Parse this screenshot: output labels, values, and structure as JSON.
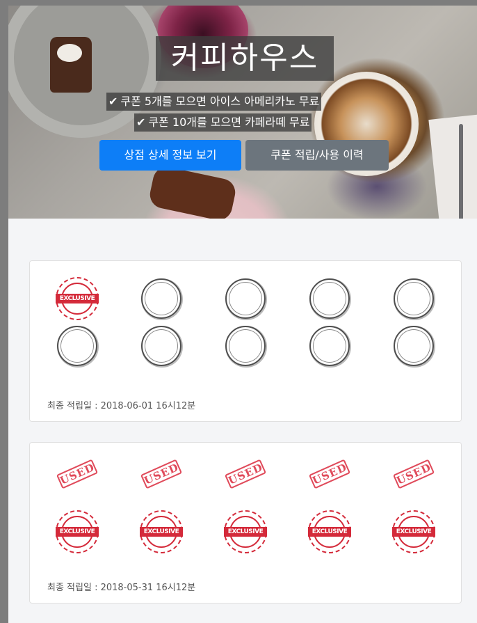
{
  "hero": {
    "title": "커피하우스",
    "reward_lines": [
      "쿠폰 5개를 모으면 아이스 아메리카노 무료",
      "쿠폰 10개를 모으면 카페라떼 무료"
    ],
    "buttons": {
      "store_detail": "상점 상세 정보 보기",
      "coupon_history": "쿠폰 적립/사용 이력"
    }
  },
  "cards": [
    {
      "slots": [
        "exclusive",
        "empty",
        "empty",
        "empty",
        "empty",
        "empty",
        "empty",
        "empty",
        "empty",
        "empty"
      ],
      "last_stamp": "최종 적립일 : 2018-06-01 16시12분"
    },
    {
      "slots": [
        "used",
        "used",
        "used",
        "used",
        "used",
        "exclusive",
        "exclusive",
        "exclusive",
        "exclusive",
        "exclusive"
      ],
      "last_stamp": "최종 적립일 : 2018-05-31 16시12분"
    }
  ],
  "stamp_labels": {
    "exclusive": "EXCLUSIVE",
    "used": "USED"
  },
  "colors": {
    "primary": "#0d7ef7",
    "secondary": "#6c757d",
    "stamp_red": "#d42a3a"
  }
}
